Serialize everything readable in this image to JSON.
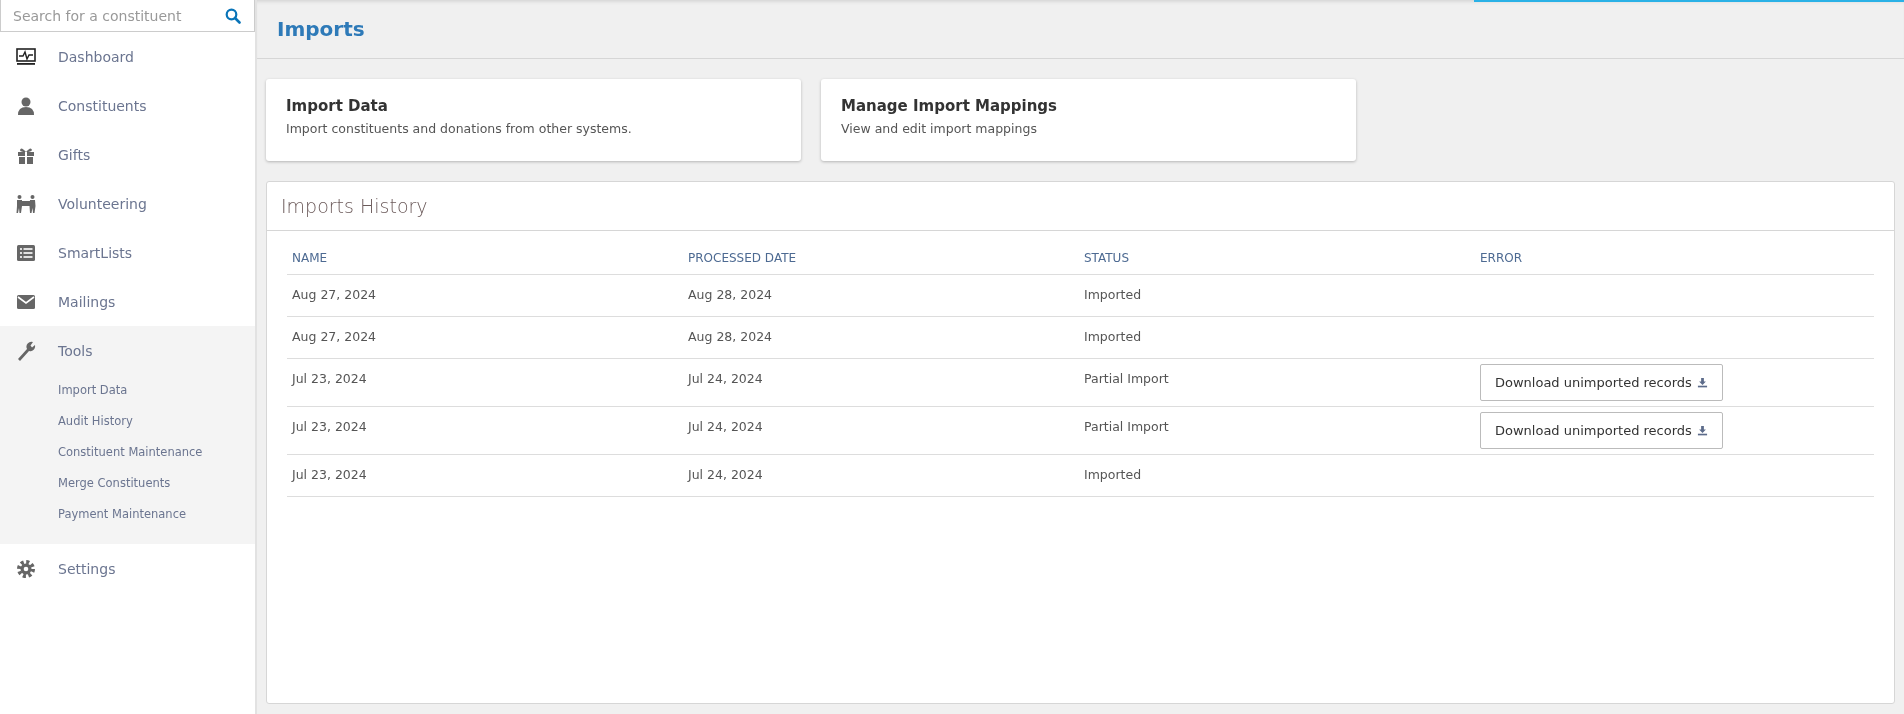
{
  "search": {
    "placeholder": "Search for a constituent"
  },
  "sidebar": {
    "items": [
      {
        "label": "Dashboard",
        "expanded": false
      },
      {
        "label": "Constituents",
        "expanded": false
      },
      {
        "label": "Gifts",
        "expanded": false
      },
      {
        "label": "Volunteering",
        "expanded": false
      },
      {
        "label": "SmartLists",
        "expanded": false
      },
      {
        "label": "Mailings",
        "expanded": false
      },
      {
        "label": "Tools",
        "expanded": true,
        "children": [
          {
            "label": "Import Data"
          },
          {
            "label": "Audit History"
          },
          {
            "label": "Constituent Maintenance"
          },
          {
            "label": "Merge Constituents"
          },
          {
            "label": "Payment Maintenance"
          }
        ]
      },
      {
        "label": "Settings",
        "expanded": false
      }
    ]
  },
  "page_title": "Imports",
  "cards": [
    {
      "title": "Import Data",
      "description": "Import constituents and donations from other systems."
    },
    {
      "title": "Manage Import Mappings",
      "description": "View and edit import mappings"
    }
  ],
  "history": {
    "title": "Imports History",
    "columns": [
      "NAME",
      "PROCESSED DATE",
      "STATUS",
      "ERROR"
    ],
    "rows": [
      {
        "name": "Aug 27, 2024",
        "processed_date": "Aug 28, 2024",
        "status": "Imported"
      },
      {
        "name": "Aug 27, 2024",
        "processed_date": "Aug 28, 2024",
        "status": "Imported"
      },
      {
        "name": "Jul 23, 2024",
        "processed_date": "Jul 24, 2024",
        "status": "Partial Import",
        "error_button": "Download unimported records"
      },
      {
        "name": "Jul 23, 2024",
        "processed_date": "Jul 24, 2024",
        "status": "Partial Import",
        "error_button": "Download unimported records"
      },
      {
        "name": "Jul 23, 2024",
        "processed_date": "Jul 24, 2024",
        "status": "Imported"
      }
    ]
  }
}
